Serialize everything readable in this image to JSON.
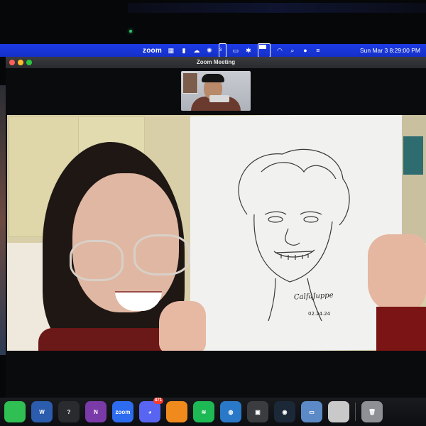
{
  "menubar": {
    "app_name": "zoom",
    "datetime": "Sun Mar 3  8:29:00 PM",
    "status_icons": [
      "grid-icon",
      "mic-icon",
      "cloud-icon",
      "settings-icon",
      "calendar-icon",
      "display-icon",
      "bluetooth-icon",
      "battery-icon",
      "wifi-icon",
      "search-icon",
      "user-icon",
      "control-center-icon"
    ],
    "calendar_badge": "3"
  },
  "window": {
    "title": "Zoom Meeting"
  },
  "drawing": {
    "signature": "CalfaJuppe",
    "date": "02.24.24"
  },
  "dock": {
    "apps": [
      {
        "name": "facetime",
        "color": "#2fbf52",
        "label": ""
      },
      {
        "name": "word",
        "color": "#2b5cad",
        "label": "W"
      },
      {
        "name": "help",
        "color": "#2a2b2f",
        "label": "?"
      },
      {
        "name": "onenote",
        "color": "#7a3aa8",
        "label": "N"
      },
      {
        "name": "zoom",
        "color": "#2d6cf0",
        "label": "zoom"
      },
      {
        "name": "discord",
        "color": "#5865f2",
        "label": "◕"
      },
      {
        "name": "books",
        "color": "#f08a1c",
        "label": ""
      },
      {
        "name": "spotify",
        "color": "#1db954",
        "label": "≋"
      },
      {
        "name": "network",
        "color": "#2a78c8",
        "label": "◍"
      },
      {
        "name": "screenshot",
        "color": "#3b3c40",
        "label": "▣"
      },
      {
        "name": "steam",
        "color": "#1b2838",
        "label": "◉"
      },
      {
        "name": "preview",
        "color": "#5b8ac6",
        "label": "▭"
      },
      {
        "name": "archive",
        "color": "#c9c9c9",
        "label": ""
      },
      {
        "name": "trash",
        "color": "#8e9096",
        "label": "🗑"
      }
    ],
    "discord_badge": "871"
  }
}
